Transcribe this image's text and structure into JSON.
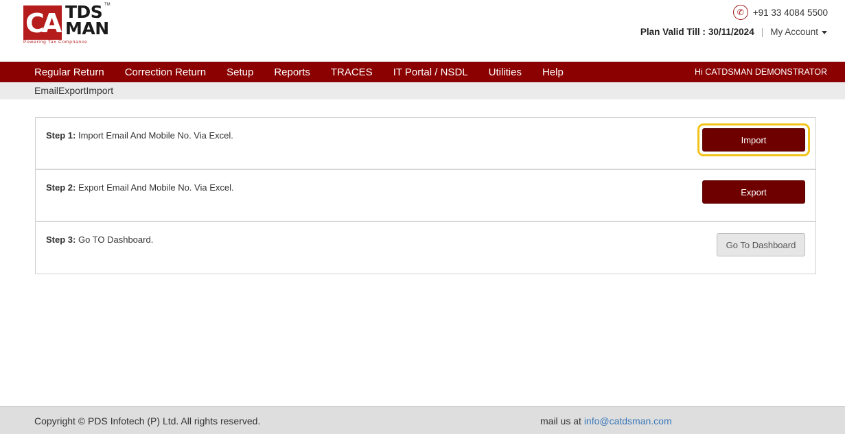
{
  "brand": {
    "logo_mark": "CA",
    "logo_line1": "TDS",
    "logo_line2": "MAN",
    "tm": "TM",
    "tagline": "Powering Tax Compliance",
    "color": "#b51c1c"
  },
  "header": {
    "phone": "+91 33 4084 5500",
    "plan_label": "Plan Valid Till :",
    "plan_date": "30/11/2024",
    "separator": "|",
    "my_account": "My Account"
  },
  "nav": {
    "items": [
      "Regular Return",
      "Correction Return",
      "Setup",
      "Reports",
      "TRACES",
      "IT Portal / NSDL",
      "Utilities",
      "Help"
    ],
    "user_greeting": "Hi CATDSMAN DEMONSTRATOR",
    "background": "#8b0000"
  },
  "breadcrumb": "EmailExportImport",
  "steps": [
    {
      "num": "Step 1:",
      "text": " Import Email And Mobile No. Via Excel.",
      "button": "Import"
    },
    {
      "num": "Step 2:",
      "text": " Export Email And Mobile No. Via Excel.",
      "button": "Export"
    },
    {
      "num": "Step 3:",
      "text": " Go TO Dashboard.",
      "button": "Go To Dashboard"
    }
  ],
  "footer": {
    "copyright": "Copyright © PDS Infotech (P) Ltd. All rights reserved.",
    "mail_prefix": "mail us at ",
    "email": "info@catdsman.com"
  },
  "colors": {
    "primary_button": "#6e0000",
    "highlight": "#f2c318",
    "link": "#3a77b8"
  },
  "icons": {
    "phone": "phone-icon",
    "caret": "caret-down-icon"
  }
}
